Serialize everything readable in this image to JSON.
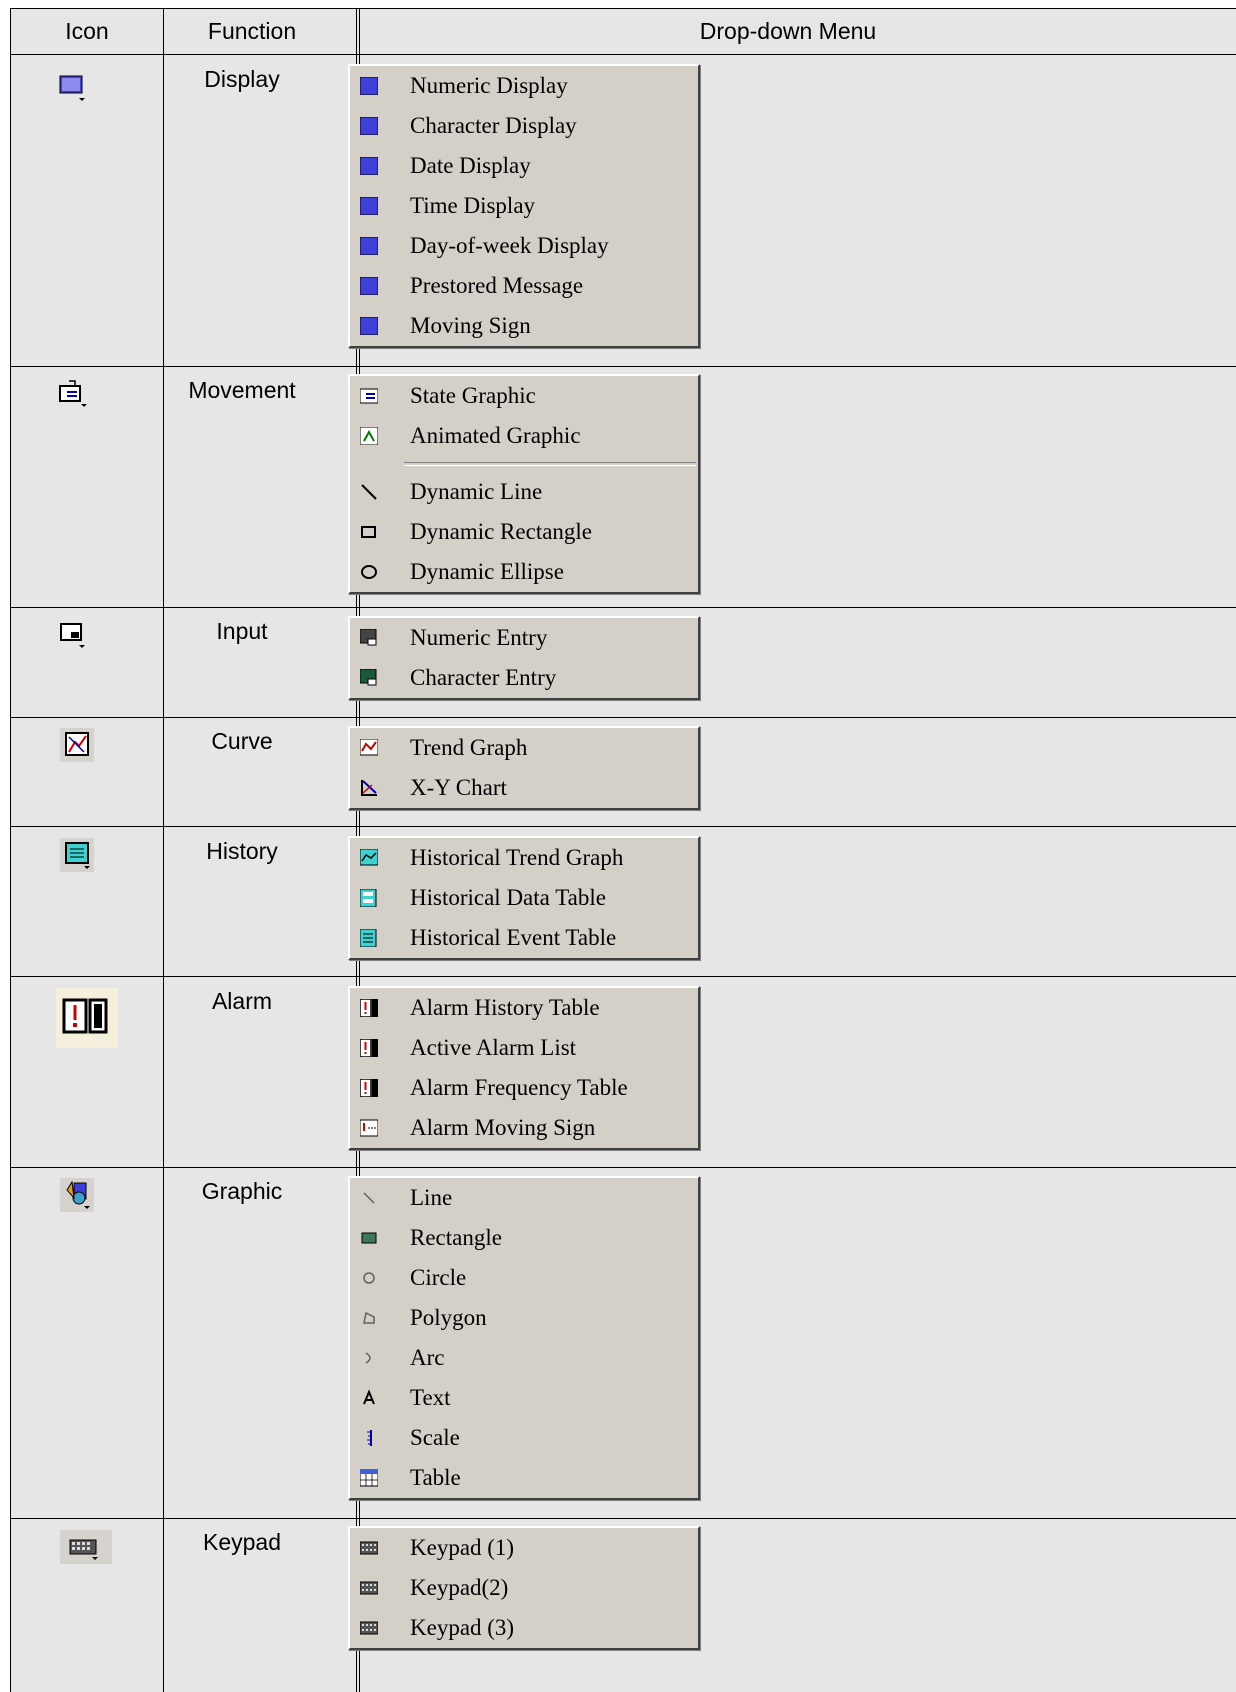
{
  "header": {
    "col_icon": "Icon",
    "col_function": "Function",
    "col_menu": "Drop-down Menu"
  },
  "rows": [
    {
      "function": "Display",
      "icon": "display-toolbar-icon",
      "items": [
        "Numeric Display",
        "Character Display",
        "Date Display",
        "Time Display",
        "Day-of-week Display",
        "Prestored Message",
        "Moving Sign"
      ]
    },
    {
      "function": "Movement",
      "icon": "movement-toolbar-icon",
      "items": [
        "State Graphic",
        "Animated Graphic",
        "Dynamic Line",
        "Dynamic Rectangle",
        "Dynamic Ellipse"
      ]
    },
    {
      "function": "Input",
      "icon": "input-toolbar-icon",
      "items": [
        "Numeric Entry",
        "Character Entry"
      ]
    },
    {
      "function": "Curve",
      "icon": "curve-toolbar-icon",
      "items": [
        "Trend Graph",
        "X-Y Chart"
      ]
    },
    {
      "function": "History",
      "icon": "history-toolbar-icon",
      "items": [
        "Historical Trend Graph",
        "Historical Data Table",
        "Historical Event Table"
      ]
    },
    {
      "function": "Alarm",
      "icon": "alarm-toolbar-icon",
      "items": [
        "Alarm History Table",
        "Active Alarm List",
        "Alarm Frequency Table",
        "Alarm Moving Sign"
      ]
    },
    {
      "function": "Graphic",
      "icon": "graphic-toolbar-icon",
      "items": [
        "Line",
        "Rectangle",
        "Circle",
        "Polygon",
        "Arc",
        "Text",
        "Scale",
        "Table"
      ]
    },
    {
      "function": "Keypad",
      "icon": "keypad-toolbar-icon",
      "items": [
        "Keypad (1)",
        "Keypad(2)",
        "Keypad (3)"
      ]
    }
  ],
  "colors": {
    "menu_bg": "#d4d0c8",
    "table_bg": "#e6e6e6",
    "grid": "#000000",
    "icon_blue": "#3f3fd9",
    "alarm_red": "#cc0000"
  }
}
